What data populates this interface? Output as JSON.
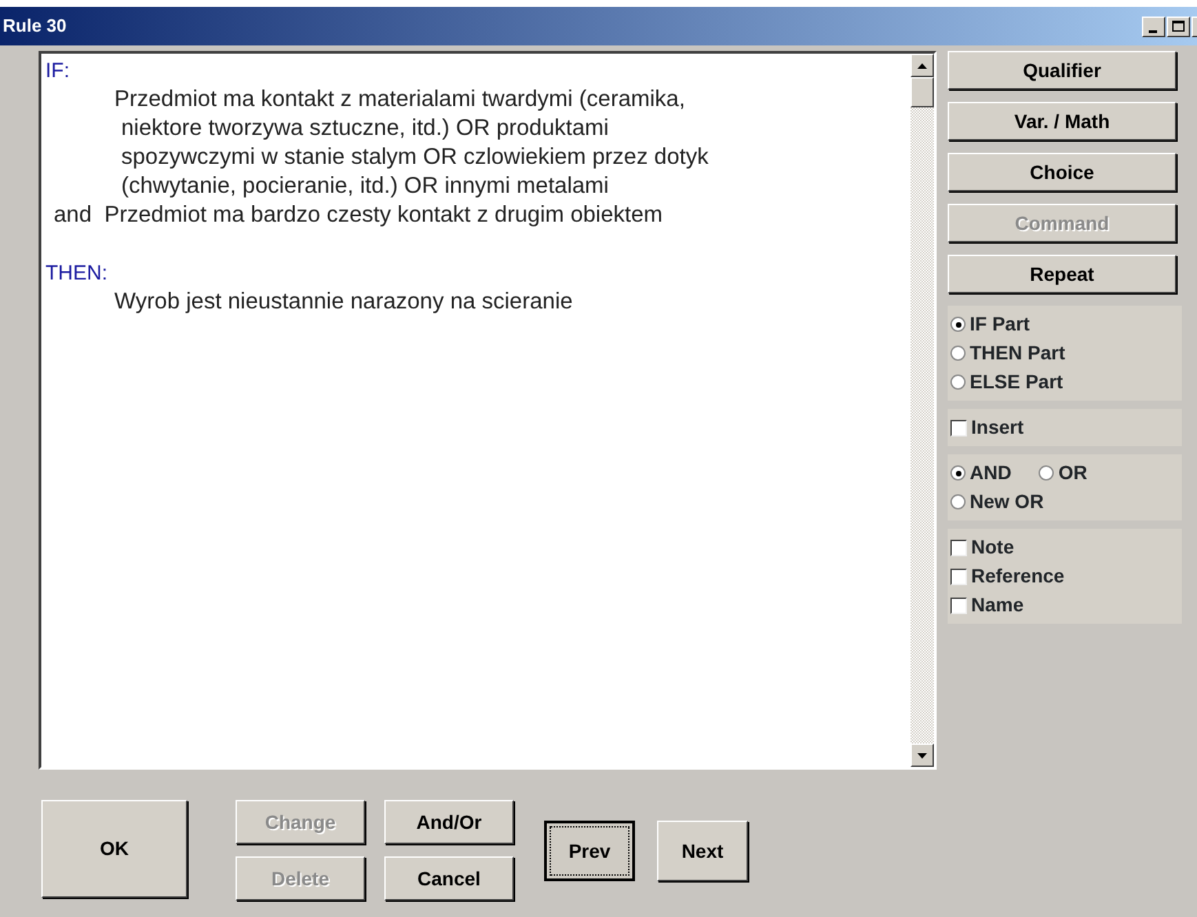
{
  "window": {
    "title": "Rule 30"
  },
  "rule_lines": [
    {
      "kind": "heading",
      "text": "IF:"
    },
    {
      "kind": "condition",
      "text": "Przedmiot ma kontakt z materialami twardymi (ceramika,"
    },
    {
      "kind": "continuation",
      "text": "niektore tworzywa sztuczne, itd.) OR produktami"
    },
    {
      "kind": "continuation",
      "text": "spozywczymi w stanie stalym OR czlowiekiem przez dotyk"
    },
    {
      "kind": "continuation",
      "text": "(chwytanie, pocieranie, itd.) OR innymi metalami"
    },
    {
      "kind": "connector",
      "text": "and  Przedmiot ma bardzo czesty kontakt z drugim obiektem"
    },
    {
      "kind": "heading",
      "text": "THEN:"
    },
    {
      "kind": "condition",
      "text": "Wyrob jest nieustannie narazony na scieranie"
    }
  ],
  "side_buttons": [
    {
      "label": "Qualifier",
      "disabled": false
    },
    {
      "label": "Var. / Math",
      "disabled": false
    },
    {
      "label": "Choice",
      "disabled": false
    },
    {
      "label": "Command",
      "disabled": true
    },
    {
      "label": "Repeat",
      "disabled": false
    }
  ],
  "part_options": [
    {
      "label": "IF Part",
      "selected": true
    },
    {
      "label": "THEN Part",
      "selected": false
    },
    {
      "label": "ELSE Part",
      "selected": false
    }
  ],
  "insert": {
    "label": "Insert",
    "checked": false
  },
  "connector_options": [
    {
      "label": "AND",
      "selected": true
    },
    {
      "label": "OR",
      "selected": false
    },
    {
      "label": "New OR",
      "selected": false
    }
  ],
  "extras": [
    {
      "label": "Note",
      "checked": false
    },
    {
      "label": "Reference",
      "checked": false
    },
    {
      "label": "Name",
      "checked": false
    }
  ],
  "bottom_buttons": {
    "ok": {
      "label": "OK"
    },
    "edit": [
      {
        "label": "Change",
        "disabled": true
      },
      {
        "label": "Delete",
        "disabled": true
      }
    ],
    "logic": [
      {
        "label": "And/Or",
        "disabled": false
      },
      {
        "label": "Cancel",
        "disabled": false
      }
    ],
    "nav": [
      {
        "label": "Prev",
        "focused": true
      },
      {
        "label": "Next",
        "focused": false
      }
    ]
  }
}
